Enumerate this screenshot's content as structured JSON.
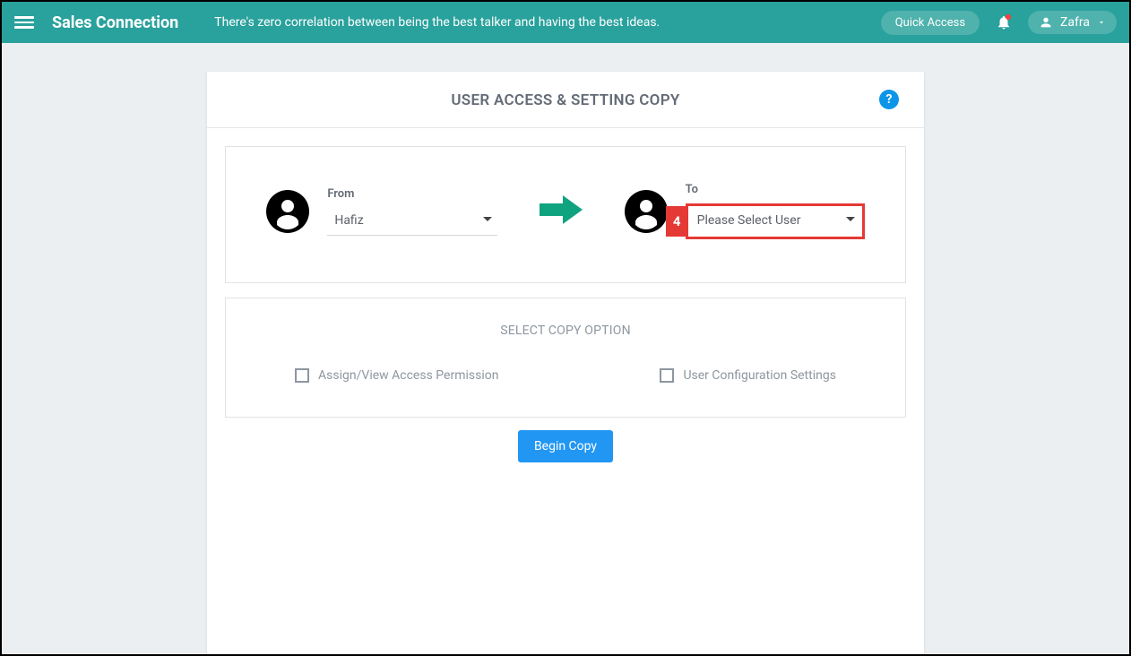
{
  "header": {
    "app_title": "Sales Connection",
    "tagline": "There's zero correlation between being the best talker and having the best ideas.",
    "quick_access": "Quick Access",
    "user_name": "Zafra"
  },
  "card": {
    "title": "USER ACCESS & SETTING COPY",
    "help_symbol": "?"
  },
  "from": {
    "label": "From",
    "selected": "Hafiz"
  },
  "to": {
    "label": "To",
    "placeholder": "Please Select User",
    "badge": "4"
  },
  "copy_options": {
    "title": "SELECT COPY OPTION",
    "option1": "Assign/View Access Permission",
    "option2": "User Configuration Settings"
  },
  "begin_button": "Begin Copy"
}
